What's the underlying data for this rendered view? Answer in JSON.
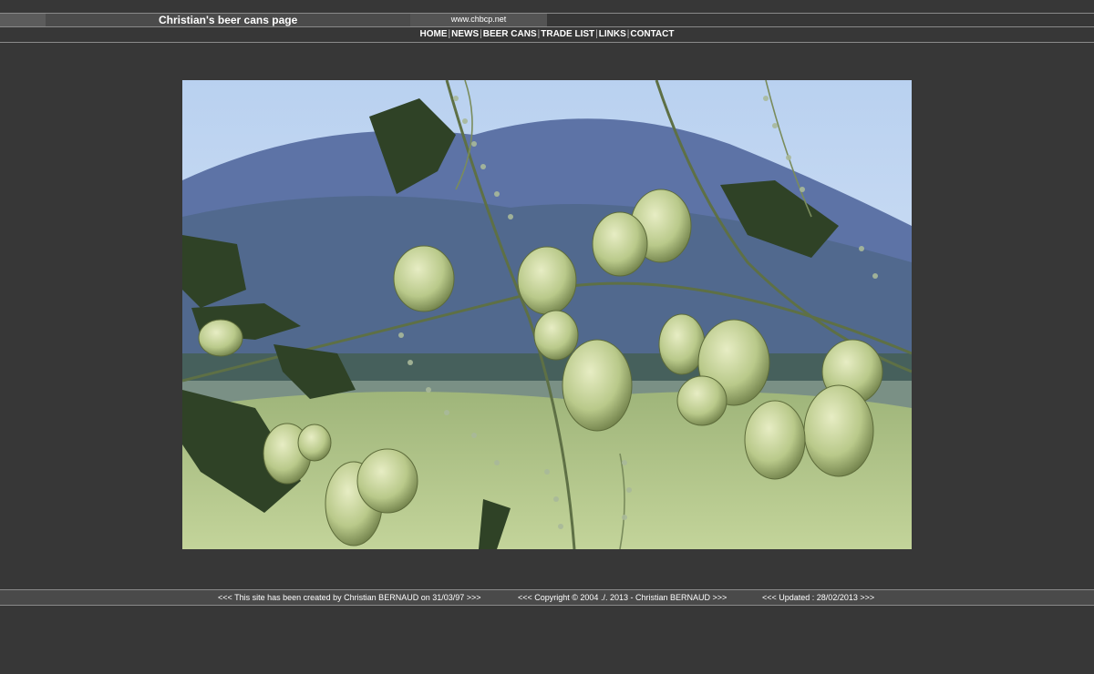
{
  "header": {
    "title": "Christian's beer cans page",
    "url": "www.chbcp.net"
  },
  "nav": {
    "items": [
      {
        "label": "HOME"
      },
      {
        "label": "NEWS"
      },
      {
        "label": "BEER CANS"
      },
      {
        "label": "TRADE LIST"
      },
      {
        "label": "LINKS"
      },
      {
        "label": "CONTACT"
      }
    ],
    "separator": "|"
  },
  "photo": {
    "subject": "hops",
    "colors": {
      "sky": "#c9dcf4",
      "mountain": "#5d73a6",
      "meadow": "#b6c98a",
      "hop_cone": "#c9d59a",
      "leaf": "#2f4226"
    }
  },
  "footer": {
    "created": "<<< This site has been created by Christian BERNAUD on 31/03/97 >>>",
    "copyright": "<<< Copyright © 2004 ./. 2013 - Christian BERNAUD >>>",
    "updated": "<<< Updated : 28/02/2013 >>>"
  },
  "colors": {
    "background": "#373737",
    "bar_border": "#8a8a8a",
    "text": "#ffffff"
  }
}
